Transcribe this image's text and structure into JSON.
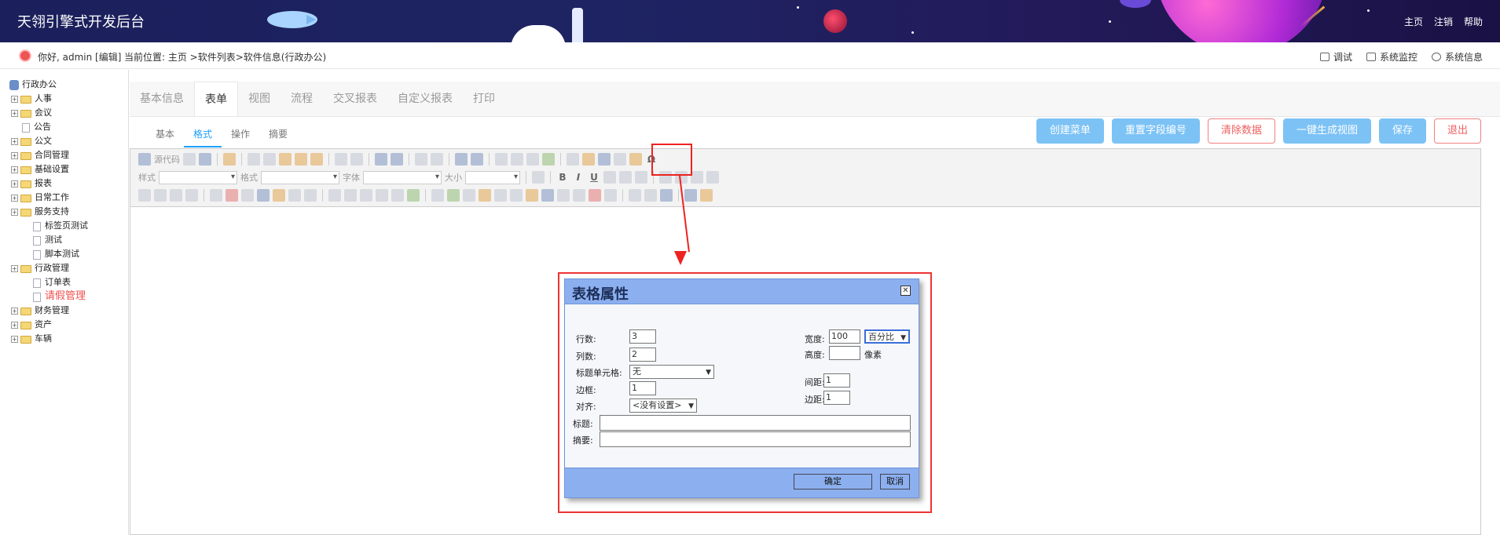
{
  "header": {
    "brand": "天翎引擎式开发后台",
    "links": [
      "主页",
      "注销",
      "帮助"
    ]
  },
  "subbar": {
    "hello": "你好, admin [编辑]",
    "crumb": "当前位置: 主页 >软件列表>软件信息(行政办公)",
    "tools": [
      "调试",
      "系统监控",
      "系统信息"
    ]
  },
  "tree": {
    "root": "行政办公",
    "items": [
      {
        "label": "人事",
        "type": "folder"
      },
      {
        "label": "会议",
        "type": "folder"
      },
      {
        "label": "公告",
        "type": "doc"
      },
      {
        "label": "公文",
        "type": "folder"
      },
      {
        "label": "合同管理",
        "type": "folder"
      },
      {
        "label": "基础设置",
        "type": "folder"
      },
      {
        "label": "报表",
        "type": "folder"
      },
      {
        "label": "日常工作",
        "type": "folder"
      },
      {
        "label": "服务支持",
        "type": "folder"
      },
      {
        "label": "标签页测试",
        "type": "doc"
      },
      {
        "label": "测试",
        "type": "doc"
      },
      {
        "label": "脚本测试",
        "type": "doc"
      },
      {
        "label": "行政管理",
        "type": "folder"
      },
      {
        "label": "订单表",
        "type": "doc"
      },
      {
        "label": "请假管理",
        "type": "doc",
        "selected": true
      },
      {
        "label": "财务管理",
        "type": "folder"
      },
      {
        "label": "资产",
        "type": "folder"
      },
      {
        "label": "车辆",
        "type": "folder"
      }
    ]
  },
  "tabs": [
    "基本信息",
    "表单",
    "视图",
    "流程",
    "交叉报表",
    "自定义报表",
    "打印"
  ],
  "subtabs": [
    "基本",
    "格式",
    "操作",
    "摘要"
  ],
  "actions": {
    "create_menu": "创建菜单",
    "reset_fields": "重置字段编号",
    "clear_data": "清除数据",
    "gen_view": "一键生成视图",
    "save": "保存",
    "exit": "退出"
  },
  "toolbar": {
    "source": "源代码",
    "style": "样式",
    "format": "格式",
    "font": "字体",
    "size": "大小"
  },
  "dialog": {
    "title": "表格属性",
    "rows_label": "行数:",
    "rows": "3",
    "cols_label": "列数:",
    "cols": "2",
    "header_label": "标题单元格:",
    "header_value": "无",
    "border_label": "边框:",
    "border": "1",
    "align_label": "对齐:",
    "align_value": "<没有设置>",
    "width_label": "宽度:",
    "width": "100",
    "width_unit": "百分比",
    "height_label": "高度:",
    "height": "",
    "height_unit": "像素",
    "spacing_label": "间距:",
    "spacing": "1",
    "padding_label": "边距:",
    "padding": "1",
    "caption_label": "标题:",
    "caption": "",
    "summary_label": "摘要:",
    "summary": "",
    "ok": "确定",
    "cancel": "取消"
  }
}
